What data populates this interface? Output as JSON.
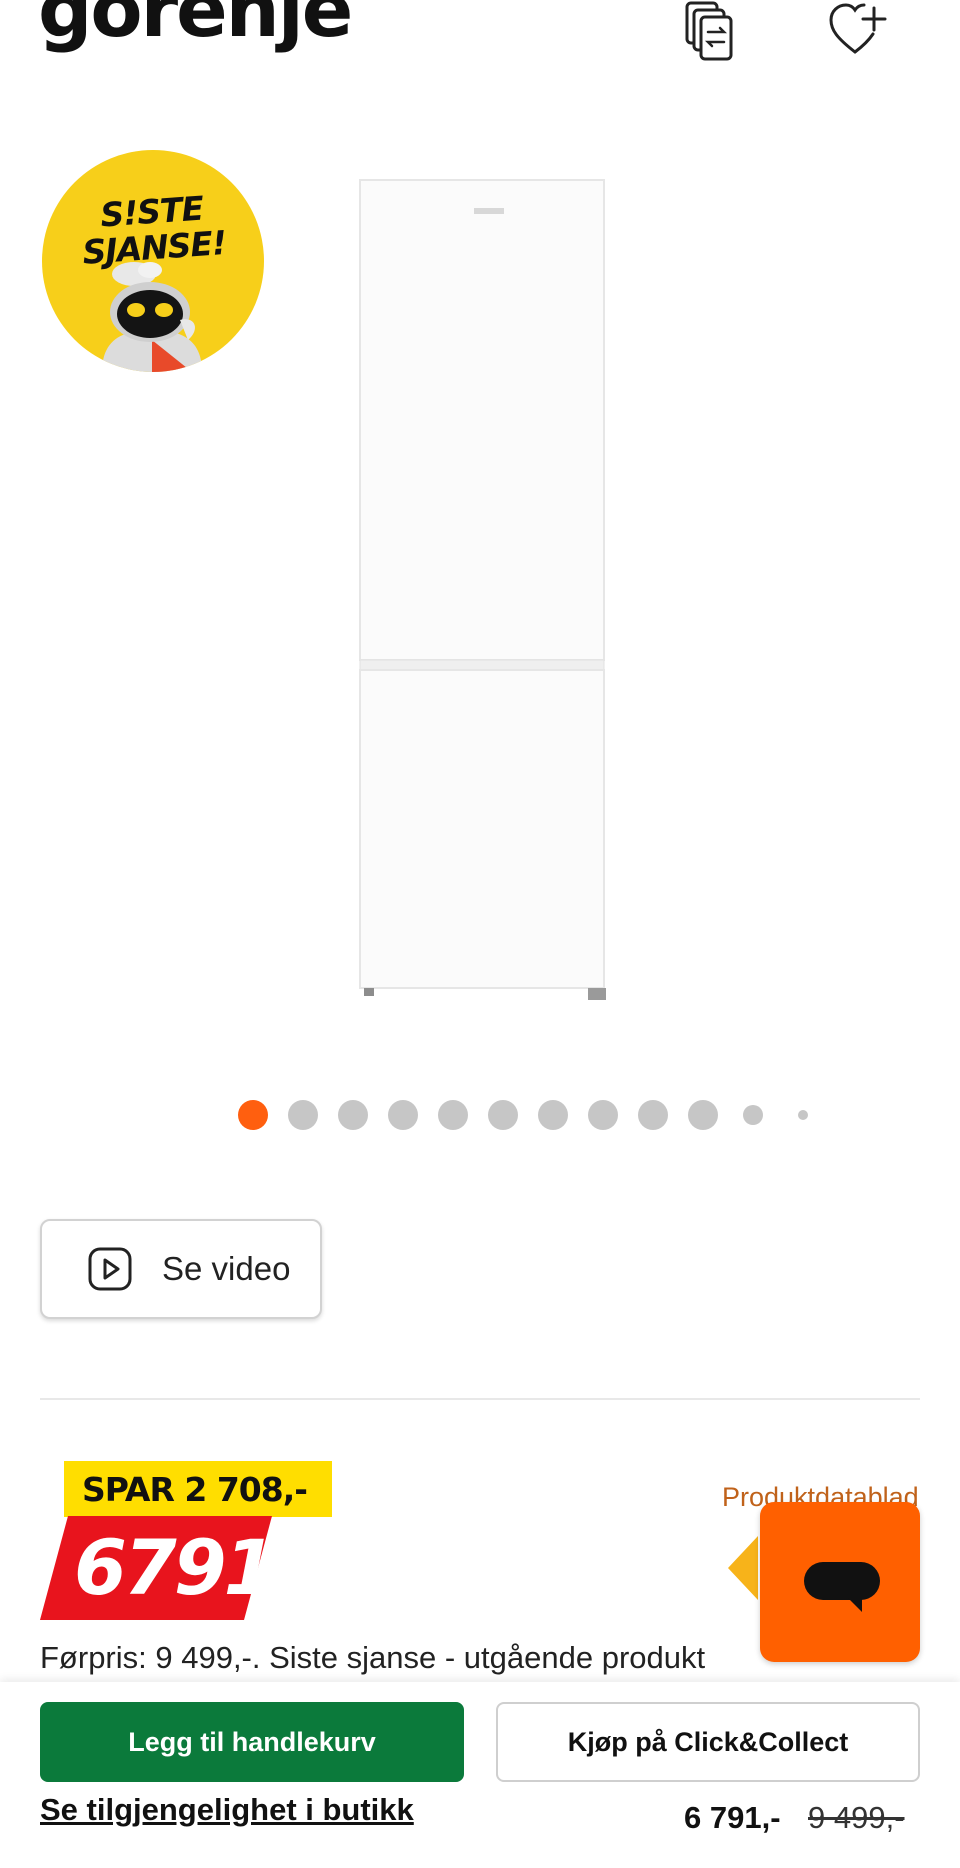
{
  "header": {
    "brand": "gorenje",
    "compare_icon": "compare-icon",
    "wishlist_icon": "heart-plus-icon"
  },
  "promo_badge": {
    "line1": "S!STE",
    "line2": "SJANSE!",
    "color": "#f7cf1a"
  },
  "gallery": {
    "total_images": 12,
    "active_index": 0,
    "active_color": "#ff5f0f"
  },
  "video": {
    "label": "Se video",
    "icon": "play-icon"
  },
  "pricing": {
    "save_label": "SPAR 2 708,-",
    "price": "6791",
    "datasheet_link": "Produktdatablad",
    "previous_price_note": "Førpris: 9 499,-. Siste sjanse - utgående produkt"
  },
  "chat": {
    "icon": "chat-icon",
    "color": "#ff6000"
  },
  "sticky_bar": {
    "add_to_cart": "Legg til handlekurv",
    "click_collect": "Kjøp på Click&Collect",
    "availability_link": "Se tilgjengelighet i butikk",
    "price": "6 791,-",
    "old_price": "9 499,-",
    "cart_color": "#0b7a3b"
  }
}
